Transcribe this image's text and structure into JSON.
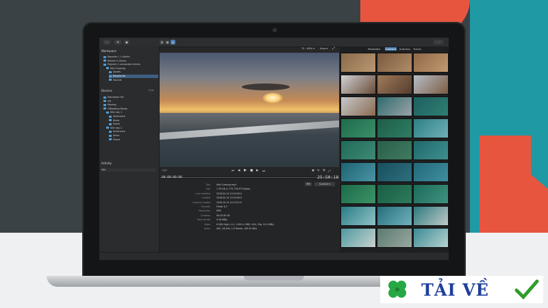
{
  "colors": {
    "accent": "#4b7cb0",
    "logo_text": "#1e3f9a",
    "check": "#2f9d2a",
    "clover": "#28a745",
    "bg_red": "#e8553f",
    "bg_teal": "#1f9aa4"
  },
  "viewer_header": {
    "zoom": "75 - 88%",
    "view": "View"
  },
  "browser_tabs": [
    "Metadata",
    "Content",
    "Subclips",
    "Tracks"
  ],
  "sidebar": {
    "workspace_title": "Workspace",
    "workspace_items": [
      {
        "label": "Reporter | 1 clients",
        "indent": 1
      },
      {
        "label": "Movies 0 clients",
        "indent": 1
      },
      {
        "label": "Projects  1 connected clients",
        "indent": 1
      },
      {
        "label": "Kite Crossing",
        "indent": 2
      },
      {
        "label": "Assets",
        "indent": 3
      },
      {
        "label": "Roughcuts",
        "indent": 3,
        "selected": true
      },
      {
        "label": "Sounds",
        "indent": 3
      }
    ],
    "devices_title": "Devices",
    "devices_hide": "Hide",
    "device_items": [
      {
        "label": "Macintosh HD",
        "indent": 1
      },
      {
        "label": "SM",
        "indent": 1
      },
      {
        "label": "Monkey",
        "indent": 1
      },
      {
        "label": "Offloading Media",
        "indent": 1
      },
      {
        "label": "Kite day 1",
        "indent": 2
      },
      {
        "label": "Actioncam",
        "indent": 3
      },
      {
        "label": "Alexa",
        "indent": 3
      },
      {
        "label": "Drone",
        "indent": 3
      },
      {
        "label": "Kite day 2",
        "indent": 2
      },
      {
        "label": "Actioncam",
        "indent": 3
      },
      {
        "label": "Alexa",
        "indent": 3
      },
      {
        "label": "Drone",
        "indent": 3
      }
    ],
    "activity_title": "Activity",
    "activity_item": "Idle"
  },
  "transport": {
    "timecode_left": "00:00:00:00",
    "timecode_right": "25:50:18"
  },
  "metadata": {
    "buttons": {
      "content": "Content"
    },
    "rows": [
      {
        "label": "Title",
        "value": "Kite Crossing.mp4"
      },
      {
        "label": "Size",
        "value": "1.76 GB (1,775,776,973 bytes)"
      },
      {
        "label": "Last modified",
        "value": "2016-04-14 10:34:59.0"
      },
      {
        "label": "Created",
        "value": "2016-04-14 10:34:59.0"
      },
      {
        "label": "Content created",
        "value": "2016-10-31 14:15:21.0"
      },
      {
        "label": "Encoder",
        "value": "Finder 8.7"
      },
      {
        "label": "Resolution",
        "value": "MP4"
      },
      {
        "label": "Duration",
        "value": "00:25:50:18"
      },
      {
        "label": "Total bitrate",
        "value": "9.18 MB/s"
      },
      {
        "label": "Video",
        "value": "H.264 High L 4.1, 1920 x 1080, 16:9, 25p, 9.01 MB/s"
      },
      {
        "label": "Audio",
        "value": "AAC, 48 kHz, 2.0 Stereo, 165.53 kB/s"
      }
    ]
  },
  "thumbnails": [
    {
      "c1": "#8a6a4a",
      "c2": "#b99872"
    },
    {
      "c1": "#7a5a3f",
      "c2": "#b08c66"
    },
    {
      "c1": "#8f6849",
      "c2": "#c19a70"
    },
    {
      "c1": "#d0d2d4",
      "c2": "#6a4c39"
    },
    {
      "c1": "#a07b5a",
      "c2": "#553d2e"
    },
    {
      "c1": "#b6bec6",
      "c2": "#7c5c44"
    },
    {
      "c1": "#c6c9cc",
      "c2": "#8b6a50"
    },
    {
      "c1": "#2f6b6e",
      "c2": "#9aa3a8"
    },
    {
      "c1": "#1f5f60",
      "c2": "#2e7f72"
    },
    {
      "c1": "#1f6b4c",
      "c2": "#3a8f68"
    },
    {
      "c1": "#1d5e49",
      "c2": "#2f7d64"
    },
    {
      "c1": "#2e7f86",
      "c2": "#6fb1b7"
    },
    {
      "c1": "#206a5a",
      "c2": "#3d8a74"
    },
    {
      "c1": "#2b5e4a",
      "c2": "#3f7b60"
    },
    {
      "c1": "#1f6a6a",
      "c2": "#3f8e8e"
    },
    {
      "c1": "#1d6273",
      "c2": "#4a95a5"
    },
    {
      "c1": "#184f5c",
      "c2": "#2d6f7f"
    },
    {
      "c1": "#22697a",
      "c2": "#3f8ea0"
    },
    {
      "c1": "#1c6a4a",
      "c2": "#3c9466"
    },
    {
      "c1": "#1a5e45",
      "c2": "#2e7a5c"
    },
    {
      "c1": "#1d6b5b",
      "c2": "#40927e"
    },
    {
      "c1": "#2b7c86",
      "c2": "#8fc3c7"
    },
    {
      "c1": "#256e7c",
      "c2": "#6fb1bb"
    },
    {
      "c1": "#2c7a80",
      "c2": "#bfc9c5"
    },
    {
      "c1": "#4d9aa0",
      "c2": "#c9d2cf"
    },
    {
      "c1": "#5a7a70",
      "c2": "#9aa8a0"
    },
    {
      "c1": "#3a8a95",
      "c2": "#b8d3d1"
    }
  ],
  "logo": {
    "text": "TẢI VỀ"
  }
}
